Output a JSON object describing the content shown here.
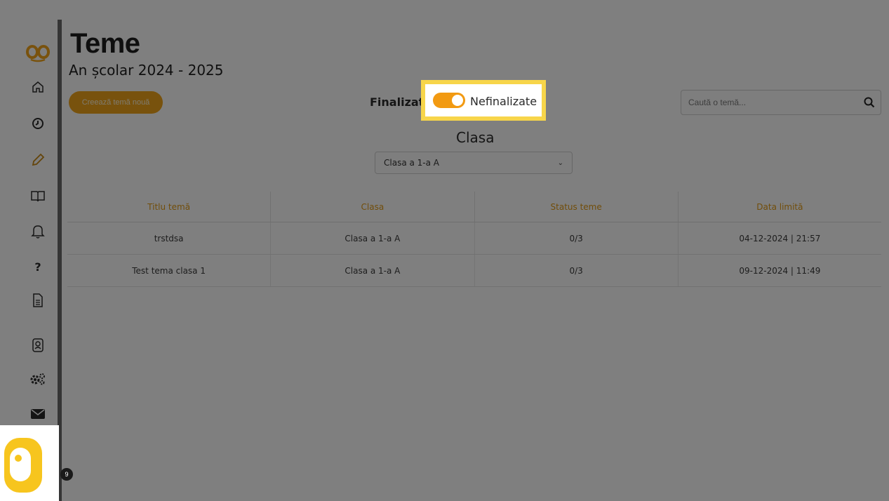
{
  "page": {
    "title": "Teme",
    "subtitle": "An școlar 2024 - 2025"
  },
  "toolbar": {
    "new_button_label": "Creează temă nouă",
    "toggle_left_label": "Finalizate",
    "toggle_right_label": "Nefinalizate",
    "toggle_state": "on",
    "search_placeholder": "Caută o temă..."
  },
  "filter": {
    "label": "Clasa",
    "selected": "Clasa a 1-a A"
  },
  "table": {
    "columns": [
      "Titlu temă",
      "Clasa",
      "Status teme",
      "Data limită"
    ],
    "rows": [
      [
        "trstdsa",
        "Clasa a 1-a A",
        "0/3",
        "04-12-2024 | 21:57"
      ],
      [
        "Test tema clasa 1",
        "Clasa a 1-a A",
        "0/3",
        "09-12-2024 | 11:49"
      ]
    ]
  },
  "sidebar": {
    "items": [
      {
        "icon": "home-icon"
      },
      {
        "icon": "clock-icon"
      },
      {
        "icon": "pencil-icon"
      },
      {
        "icon": "book-icon"
      },
      {
        "icon": "bell-icon"
      },
      {
        "icon": "help-icon"
      },
      {
        "icon": "document-icon"
      },
      {
        "icon": "contacts-icon"
      },
      {
        "icon": "settings-icon"
      },
      {
        "icon": "mail-icon"
      }
    ]
  },
  "notifications": {
    "count": "9"
  },
  "colors": {
    "accent": "#f0a51a",
    "highlight": "#f7d54a",
    "logo": "#f7c51e"
  }
}
